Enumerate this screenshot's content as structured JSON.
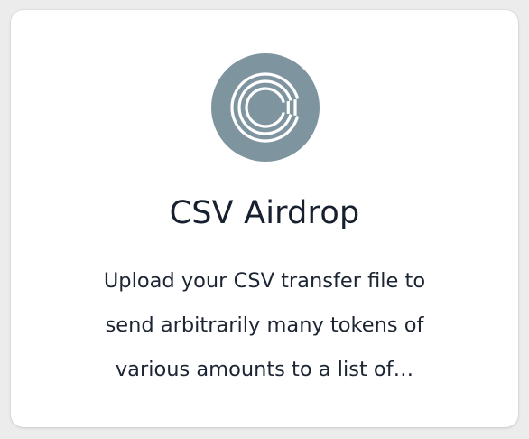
{
  "app": {
    "logo_icon": "csv-airdrop-logo-icon",
    "logo_color": "#7e949f",
    "title": "CSV Airdrop",
    "description_lines": [
      "Upload your CSV transfer file to",
      "send arbitrarily many tokens of",
      "various amounts to a list of…"
    ]
  }
}
